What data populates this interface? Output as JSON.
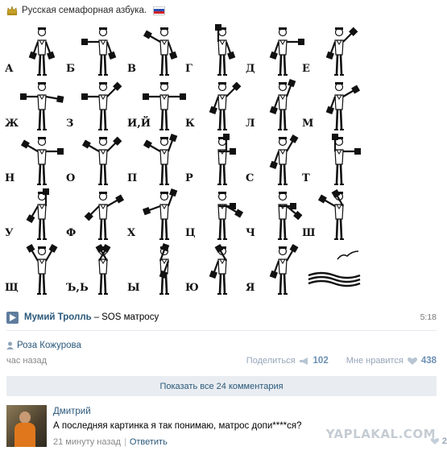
{
  "header": {
    "title": "Русская семафорная азбука.",
    "icon": "crown-icon",
    "flag": "russia-flag-icon",
    "flag_colors": [
      "#ffffff",
      "#2a4fb0",
      "#d0232a"
    ]
  },
  "semaphore": {
    "letters": [
      "А",
      "Б",
      "В",
      "Г",
      "Д",
      "Е",
      "Ж",
      "З",
      "И,Й",
      "К",
      "Л",
      "М",
      "Н",
      "О",
      "П",
      "Р",
      "С",
      "Т",
      "У",
      "Ф",
      "Х",
      "Ц",
      "Ч",
      "Ш",
      "Щ",
      "Ъ,Ь",
      "Ы",
      "Ю",
      "Я"
    ],
    "last_image": "seagull-waves-icon"
  },
  "audio": {
    "artist": "Мумий Тролль",
    "separator": "–",
    "track": "SOS матросу",
    "duration": "5:18"
  },
  "post": {
    "author": "Роза Кожурова",
    "time": "час назад",
    "share_label": "Поделиться",
    "share_count": "102",
    "like_label": "Мне нравится",
    "like_count": "438"
  },
  "comments": {
    "show_all_label": "Показать все 24 комментария",
    "items": [
      {
        "author": "Дмитрий",
        "text": "А последняя картинка я так понимаю, матрос допи****ся?",
        "time": "21 минуту назад",
        "separator": "|",
        "reply_label": "Ответить",
        "like_count": "2"
      }
    ]
  },
  "watermark": "YAPLAKAL.COM",
  "colors": {
    "link": "#2b587a",
    "muted": "#888888",
    "counter": "#6d8fb3",
    "bar_bg": "#e9edf1",
    "flag_dark": "#111111"
  }
}
